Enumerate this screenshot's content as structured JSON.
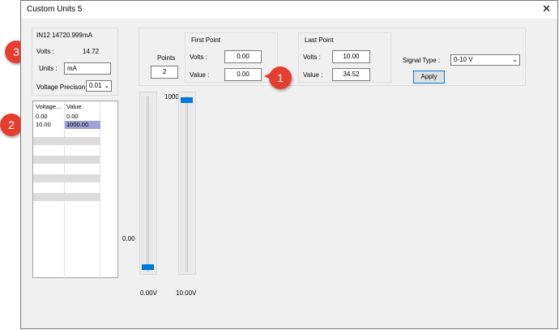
{
  "window": {
    "title": "Custom Units 5",
    "close_glyph": "✕"
  },
  "status": {
    "input_name": "IN12",
    "input_value": "14720.999",
    "input_unit": "mA",
    "volts_label": "Volts :",
    "volts_value": "14.72",
    "units_label": "Units :",
    "units_value": "mA",
    "precision_label": "Voltage Precison",
    "precision_value": "0.01"
  },
  "points": {
    "label": "Points",
    "value": "2"
  },
  "first_point": {
    "title": "First Point",
    "volts_label": "Volts :",
    "volts": "0.00",
    "value_label": "Value :",
    "value": "0.00"
  },
  "last_point": {
    "title": "Last Point",
    "volts_label": "Volts :",
    "volts": "10.00",
    "value_label": "Value :",
    "value": "34.52"
  },
  "signal": {
    "label": "Signal Type :",
    "value": "0-10 V"
  },
  "apply_label": "Apply",
  "table": {
    "headers": [
      "Voltage...",
      "Value"
    ],
    "rows": [
      [
        "0.00",
        "0.00"
      ],
      [
        "10.00",
        "1000.00"
      ]
    ]
  },
  "sliders": {
    "left_value_label": "0.00",
    "top_value_label": "1000",
    "left_caption": "0.00V",
    "right_caption": "10.00V",
    "left_level": 0.0,
    "right_level": 1.0
  },
  "callouts": [
    "1",
    "2",
    "3"
  ],
  "colors": {
    "accent": "#0078d7",
    "callout": "#e53d2f",
    "selected_cell": "#9ea0d6"
  },
  "icons": {
    "dropdown": "chevron-down-icon",
    "close": "close-icon"
  }
}
